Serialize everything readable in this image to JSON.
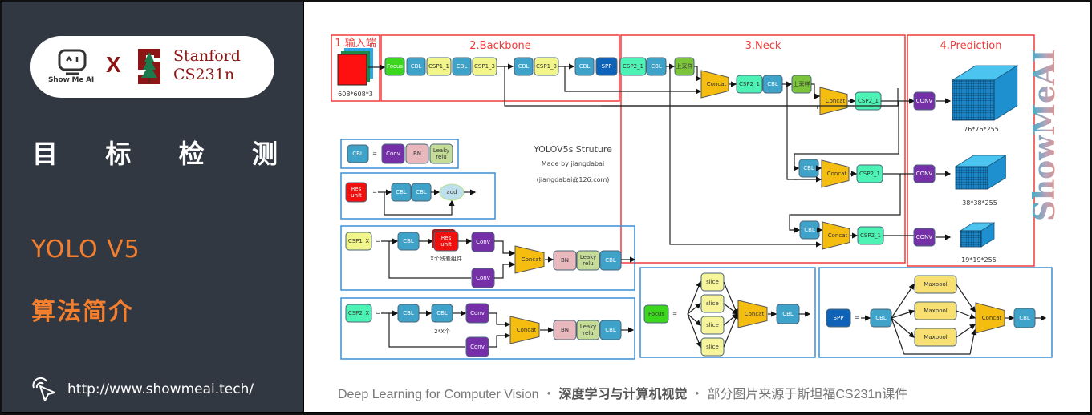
{
  "sidebar": {
    "brand_left": "Show Me AI",
    "times_symbol": "X",
    "brand_right_line1": "Stanford",
    "brand_right_line2": "CS231n",
    "topic_chars": [
      "目",
      "标",
      "检",
      "测"
    ],
    "subtitle_en": "YOLO V5",
    "subtitle_cn": "算法简介",
    "url": "http://www.showmeai.tech/",
    "accent_color": "#f47f2e",
    "background_color": "#323842"
  },
  "footer": {
    "course_en": "Deep Learning for Computer Vision",
    "separator": "・",
    "course_cn": "深度学习与计算机视觉",
    "source_note": "部分图片来源于斯坦福CS231n课件"
  },
  "watermark": "ShowMeAI",
  "diagram": {
    "title": "YOLOV5s Struture",
    "author": "Made by jiangdabai",
    "email": "(jiangdabai@126.com)",
    "sections": [
      {
        "label": "1.输入端"
      },
      {
        "label": "2.Backbone"
      },
      {
        "label": "3.Neck"
      },
      {
        "label": "4.Prediction"
      }
    ],
    "input_size": "608*608*3",
    "backbone_nodes": [
      "Focus",
      "CBL",
      "CSP1_1",
      "CBL",
      "CSP1_3",
      "CBL",
      "CSP1_3",
      "CBL",
      "SPP"
    ],
    "neck_nodes": {
      "csp2": "CSP2_1",
      "cbl": "CBL",
      "upsample": "上采样",
      "concat": "Concat"
    },
    "prediction": {
      "conv": "CONV",
      "outputs": [
        "76*76*255",
        "38*38*255",
        "19*19*255"
      ]
    },
    "legend": {
      "cbl": {
        "name": "CBL",
        "parts": [
          "Conv",
          "BN",
          "Leaky relu"
        ]
      },
      "res_unit": {
        "name": "Res unit",
        "parts": [
          "CBL",
          "CBL",
          "add"
        ]
      },
      "csp1": {
        "name": "CSP1_X",
        "parts": [
          "CBL",
          "Res unit",
          "Conv",
          "Conv",
          "Concat",
          "BN",
          "Leaky relu",
          "CBL"
        ],
        "note": "X个残差组件"
      },
      "csp2": {
        "name": "CSP2_X",
        "parts": [
          "CBL",
          "CBL",
          "Conv",
          "Conv",
          "Concat",
          "BN",
          "Leaky relu",
          "CBL"
        ],
        "note": "2*X个"
      },
      "focus": {
        "name": "Focus",
        "parts": [
          "slice",
          "slice",
          "slice",
          "slice",
          "Concat",
          "CBL"
        ]
      },
      "spp": {
        "name": "SPP",
        "parts": [
          "CBL",
          "Maxpool",
          "Maxpool",
          "Maxpool",
          "Concat",
          "CBL"
        ]
      }
    },
    "colors": {
      "section_border": "#f03a3a",
      "legend_border": "#3a8fd6",
      "cbl": "#3fa2c8",
      "csp1": "#f2f58a",
      "csp2": "#4df2b5",
      "focus": "#3cd61e",
      "spp": "#0e63b8",
      "conv": "#7530a8",
      "bn": "#e8b8bc",
      "leaky": "#c5dd98",
      "concat": "#f6bd11",
      "res": "#f01010",
      "upsample": "#7cc43c",
      "maxpool": "#f7df72",
      "slice": "#f6f59a",
      "cube": "#2aa0e0"
    }
  }
}
